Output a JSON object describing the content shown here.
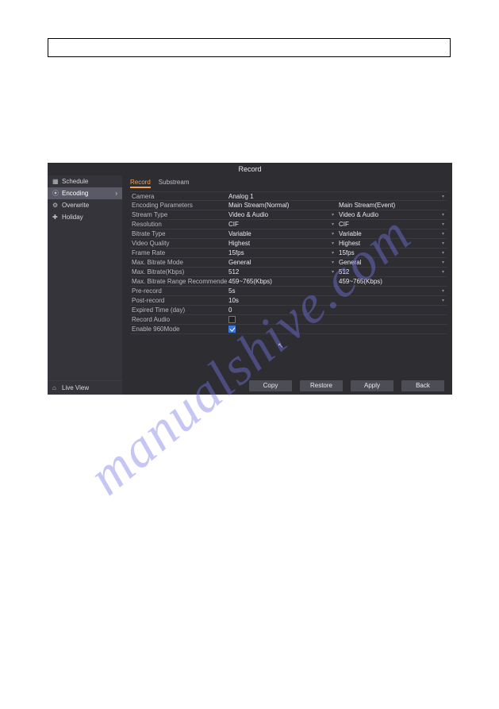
{
  "window": {
    "title": "Record"
  },
  "sidebar": {
    "items": [
      {
        "icon": "▦",
        "label": "Schedule"
      },
      {
        "icon": "⦿",
        "label": "Encoding"
      },
      {
        "icon": "⚙",
        "label": "Overwrite"
      },
      {
        "icon": "✚",
        "label": "Holiday"
      }
    ],
    "bottom": {
      "icon": "⌂",
      "label": "Live View"
    }
  },
  "tabs": [
    {
      "label": "Record"
    },
    {
      "label": "Substream"
    }
  ],
  "rows": {
    "camera": {
      "label": "Camera",
      "v1": "Analog 1",
      "v2": ""
    },
    "enc_params": {
      "label": "Encoding Parameters",
      "v1": "Main Stream(Normal)",
      "v2": "Main Stream(Event)"
    },
    "stream_type": {
      "label": "Stream Type",
      "v1": "Video & Audio",
      "v2": "Video & Audio"
    },
    "resolution": {
      "label": "Resolution",
      "v1": "CIF",
      "v2": "CIF"
    },
    "bitrate_type": {
      "label": "Bitrate Type",
      "v1": "Variable",
      "v2": "Variable"
    },
    "video_quality": {
      "label": "Video Quality",
      "v1": "Highest",
      "v2": "Highest"
    },
    "frame_rate": {
      "label": "Frame Rate",
      "v1": "15fps",
      "v2": "15fps"
    },
    "max_mode": {
      "label": "Max. Bitrate Mode",
      "v1": "General",
      "v2": "General"
    },
    "max_kbps": {
      "label": "Max. Bitrate(Kbps)",
      "v1": "512",
      "v2": "512"
    },
    "max_range": {
      "label": "Max. Bitrate Range Recommended",
      "v1": "459~765(Kbps)",
      "v2": "459~765(Kbps)"
    },
    "pre_record": {
      "label": "Pre-record",
      "v1": "5s"
    },
    "post_record": {
      "label": "Post-record",
      "v1": "10s"
    },
    "expired": {
      "label": "Expired Time (day)",
      "v1": "0"
    },
    "record_audio": {
      "label": "Record Audio"
    },
    "enable_960": {
      "label": "Enable 960Mode"
    }
  },
  "footer": {
    "copy": "Copy",
    "restore": "Restore",
    "apply": "Apply",
    "back": "Back"
  },
  "watermark": "manualshive.com"
}
